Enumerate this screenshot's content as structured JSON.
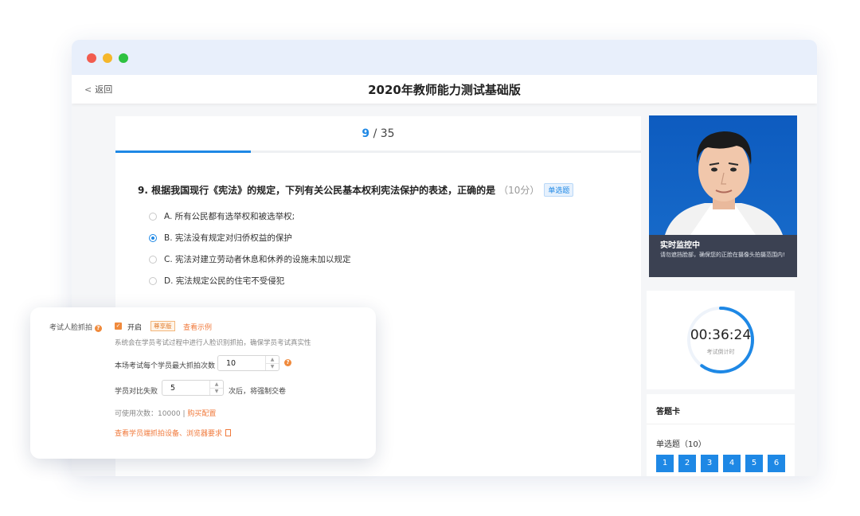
{
  "window": {
    "controls": [
      "close",
      "minimize",
      "maximize"
    ]
  },
  "header": {
    "back_label": "返回",
    "title": "2020年教师能力测试基础版"
  },
  "progress": {
    "current": "9",
    "separator": " / ",
    "total": "35",
    "fraction": 0.2571
  },
  "question": {
    "text": "9. 根据我国现行《宪法》的规定，下列有关公民基本权利宪法保护的表述，正确的是",
    "score": "（10分）",
    "type_badge": "单选题",
    "options": [
      {
        "label": "A. 所有公民都有选举权和被选举权;",
        "selected": false
      },
      {
        "label": "B. 宪法没有规定对归侨权益的保护",
        "selected": true
      },
      {
        "label": "C. 宪法对建立劳动者休息和休养的设施未加以规定",
        "selected": false
      },
      {
        "label": "D. 宪法规定公民的住宅不受侵犯",
        "selected": false
      }
    ]
  },
  "monitor": {
    "title": "实时监控中",
    "desc": "请勿遮挡脸部，确保您的正脸在摄像头拍摄范围内!"
  },
  "timer": {
    "time": "00:36:24",
    "label": "考试倒计时",
    "progress": 0.6
  },
  "answer_card": {
    "title": "答题卡",
    "section": "单选题（10）",
    "numbers": [
      "1",
      "2",
      "3",
      "4",
      "5",
      "6"
    ]
  },
  "settings": {
    "label": "考试人脸抓拍",
    "help_glyph": "?",
    "enable_label": "开启",
    "premium_badge": "尊享版",
    "example_link": "查看示例",
    "desc": "系统会在学员考试过程中进行人脸识别抓拍，确保学员考试真实性",
    "max_label": "本场考试每个学员最大抓拍次数",
    "max_value": "10",
    "fail_label": "学员对比失败",
    "fail_value": "5",
    "fail_suffix": "次后，将强制交卷",
    "available": "可使用次数：10000 |",
    "buy_link": "购买配置",
    "requirements_link": "查看学员端抓拍设备、浏览器要求"
  },
  "colors": {
    "primary": "#1e88e5",
    "accent": "#f07a3c",
    "dark_panel": "#3b4152"
  }
}
